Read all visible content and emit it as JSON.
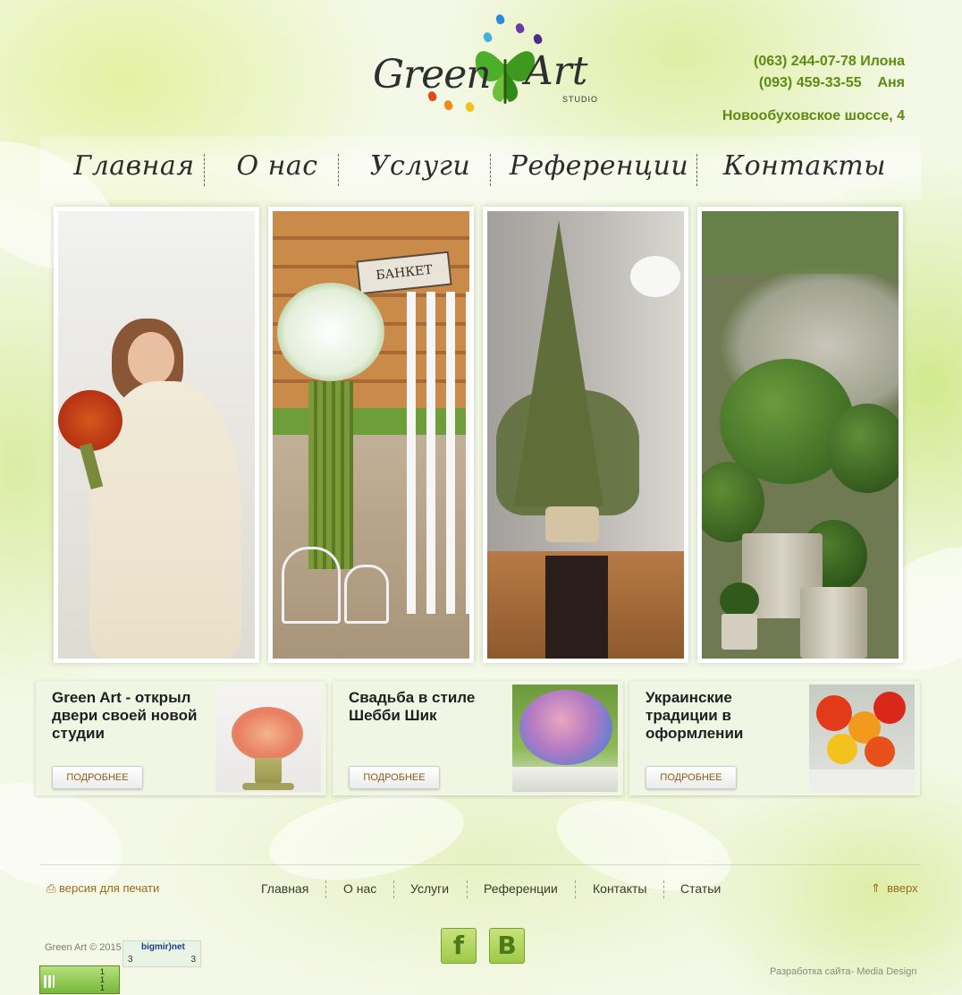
{
  "header": {
    "logo": {
      "word1": "Green",
      "word2": "Art",
      "sub": "STUDIO"
    },
    "phones": [
      {
        "number": "(063) 244-07-78",
        "name": "Илона"
      },
      {
        "number": "(093) 459-33-55",
        "name": "Аня"
      }
    ],
    "address": "Новообуховское шоссе, 4"
  },
  "nav": {
    "items": [
      "Главная",
      "О нас",
      "Услуги",
      "Референции",
      "Контакты"
    ]
  },
  "gallery": [
    {
      "alt": "bride-with-calla-bouquet"
    },
    {
      "alt": "banquet-sign-flower-decor"
    },
    {
      "alt": "moss-christmas-tree"
    },
    {
      "alt": "topiary-boxwood-pots"
    }
  ],
  "gallery_sign": "БАНКЕТ",
  "news": [
    {
      "title": "Green Art - открыл двери своей новой студии",
      "button": "ПОДРОБНЕЕ"
    },
    {
      "title": "Свадьба в стиле Шебби Шик",
      "button": "ПОДРОБНЕЕ"
    },
    {
      "title": "Украинские традиции в оформлении",
      "button": "ПОДРОБНЕЕ"
    }
  ],
  "footer": {
    "print": "версия для печати",
    "nav": [
      "Главная",
      "О нас",
      "Услуги",
      "Референции",
      "Контакты",
      "Статьи"
    ],
    "up": "вверх",
    "copyright": "Green Art © 2015",
    "counter_name": "bigmir)net",
    "counter_left": "3",
    "counter_right": "3",
    "counter2": [
      "1",
      "1",
      "1"
    ],
    "social": {
      "fb": "f",
      "vk": "B"
    },
    "developer": "Разработка сайта- Media Design"
  },
  "colors": {
    "accent_green": "#5d8b12",
    "link_brown": "#9b6a17"
  }
}
